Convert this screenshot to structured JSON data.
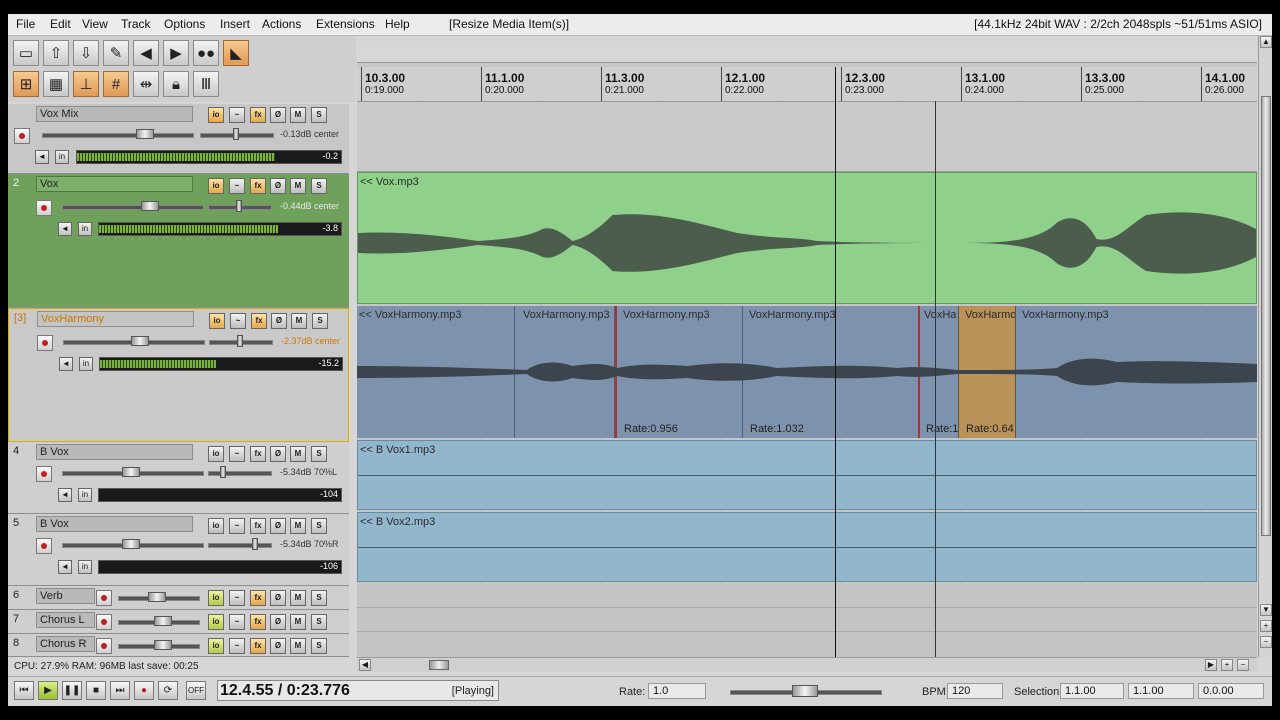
{
  "menu": {
    "items": [
      "File",
      "Edit",
      "View",
      "Track",
      "Options",
      "Insert",
      "Actions",
      "Extensions",
      "Help"
    ],
    "action_hint": "[Resize Media Item(s)]",
    "audio_status": "[44.1kHz 24bit WAV : 2/2ch 2048spls ~51/51ms ASIO]"
  },
  "toolbar": {
    "row1": [
      "new-project",
      "open-project",
      "save-project",
      "preferences",
      "undo",
      "redo",
      "auto-crossfade",
      "locking"
    ],
    "row2": [
      "ripple-edit",
      "grid",
      "snap",
      "snap-grid",
      "split",
      "lock",
      "metronome"
    ]
  },
  "tracks": [
    {
      "num": "",
      "name": "Vox Mix",
      "vol": "-0.13dB center",
      "peak": "-0.2",
      "meter": 0.85
    },
    {
      "num": "2",
      "name": "Vox",
      "vol": "-0.44dB center",
      "peak": "-3.8",
      "meter": 0.78
    },
    {
      "num": "[3]",
      "name": "VoxHarmony",
      "vol": "-2.37dB center",
      "peak": "-15.2",
      "meter": 0.5
    },
    {
      "num": "4",
      "name": "B Vox",
      "vol": "-5.34dB 70%L",
      "peak": "-104",
      "meter": 0.0
    },
    {
      "num": "5",
      "name": "B Vox",
      "vol": "-5.34dB 70%R",
      "peak": "-106",
      "meter": 0.0
    },
    {
      "num": "6",
      "name": "Verb"
    },
    {
      "num": "7",
      "name": "Chorus L"
    },
    {
      "num": "8",
      "name": "Chorus R"
    }
  ],
  "buttons": {
    "io": "io",
    "env": "~",
    "fx": "fx",
    "phase": "Ø",
    "mute": "M",
    "solo": "S",
    "in": "in"
  },
  "status": "CPU: 27.9%  RAM: 96MB  last save: 00:25",
  "ruler": [
    {
      "m": "10.3.00",
      "t": "0:19.000"
    },
    {
      "m": "11.1.00",
      "t": "0:20.000"
    },
    {
      "m": "11.3.00",
      "t": "0:21.000"
    },
    {
      "m": "12.1.00",
      "t": "0:22.000"
    },
    {
      "m": "12.3.00",
      "t": "0:23.000"
    },
    {
      "m": "13.1.00",
      "t": "0:24.000"
    },
    {
      "m": "13.3.00",
      "t": "0:25.000"
    },
    {
      "m": "14.1.00",
      "t": "0:26.000"
    }
  ],
  "items": {
    "vox": "<< Vox.mp3",
    "harmony": [
      {
        "name": "<< VoxHarmony.mp3",
        "rate": ""
      },
      {
        "name": "VoxHarmony.mp3",
        "rate": ""
      },
      {
        "name": "VoxHarmony.mp3",
        "rate": "Rate:0.956"
      },
      {
        "name": "VoxHarmony.mp3",
        "rate": "Rate:1.032"
      },
      {
        "name": "VoxHa",
        "rate": "Rate:1"
      },
      {
        "name": "VoxHarmo",
        "rate": "Rate:0.64"
      },
      {
        "name": "VoxHarmony.mp3",
        "rate": ""
      }
    ],
    "bvox1": "<< B Vox1.mp3",
    "bvox2": "<< B Vox2.mp3"
  },
  "transport": {
    "time": "12.4.55 / 0:23.776",
    "state": "[Playing]",
    "off": "OFF",
    "rate_label": "Rate:",
    "rate": "1.0",
    "bpm_label": "BPM:",
    "bpm": "120",
    "selection_label": "Selection:",
    "sel_start": "1.1.00",
    "sel_end": "1.1.00",
    "sel_len": "0.0.00"
  },
  "colors": {
    "vox": "#8fd08a",
    "harmony": "#7d93ad",
    "selected_item": "#b89258",
    "bvox": "#92b6cc",
    "wave": "#4f5a4f"
  }
}
